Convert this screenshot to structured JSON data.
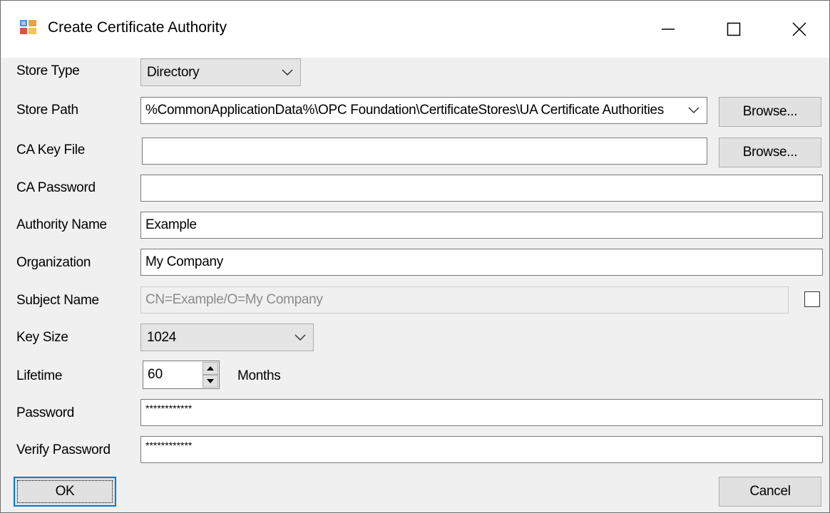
{
  "window": {
    "title": "Create Certificate Authority",
    "icon": "certificate-app-icon"
  },
  "form": {
    "store_type": {
      "label": "Store Type",
      "value": "Directory"
    },
    "store_path": {
      "label": "Store Path",
      "value": "%CommonApplicationData%\\OPC Foundation\\CertificateStores\\UA Certificate Authorities",
      "browse_label": "Browse..."
    },
    "ca_key_file": {
      "label": "CA Key File",
      "value": "",
      "browse_label": "Browse..."
    },
    "ca_password": {
      "label": "CA Password",
      "value": ""
    },
    "authority_name": {
      "label": "Authority Name",
      "value": "Example"
    },
    "organization": {
      "label": "Organization",
      "value": "My Company"
    },
    "subject_name": {
      "label": "Subject Name",
      "value": "CN=Example/O=My Company",
      "override_checked": false
    },
    "key_size": {
      "label": "Key Size",
      "value": "1024"
    },
    "lifetime": {
      "label": "Lifetime",
      "value": "60",
      "unit": "Months"
    },
    "password": {
      "label": "Password",
      "value": "************"
    },
    "verify_password": {
      "label": "Verify Password",
      "value": "************"
    }
  },
  "buttons": {
    "ok": "OK",
    "cancel": "Cancel"
  }
}
